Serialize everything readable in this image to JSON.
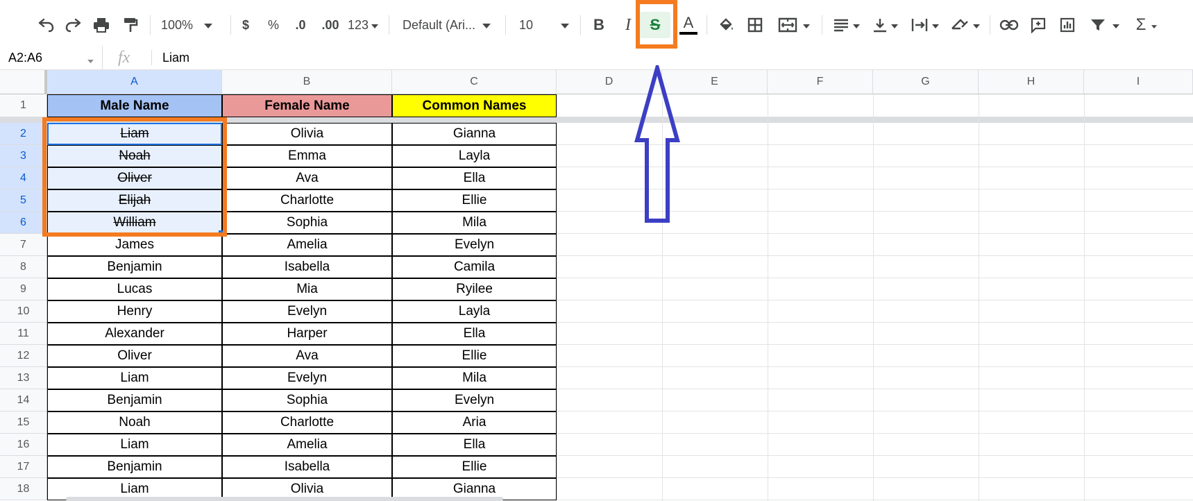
{
  "toolbar": {
    "zoom": "100%",
    "currency": "$",
    "percent": "%",
    "decrease_decimal": ".0",
    "increase_decimal": ".00",
    "number_format": "123",
    "font": "Default (Ari...",
    "font_size": "10",
    "bold": "B",
    "italic": "I",
    "strikethrough": "S",
    "text_color": "A",
    "sum": "Σ"
  },
  "formula_bar": {
    "name_box": "A2:A6",
    "fx": "fx",
    "value": "Liam"
  },
  "columns": [
    "A",
    "B",
    "C",
    "D",
    "E",
    "F",
    "G",
    "H",
    "I"
  ],
  "rows": [
    "1",
    "2",
    "3",
    "4",
    "5",
    "6",
    "7",
    "8",
    "9",
    "10",
    "11",
    "12",
    "13",
    "14",
    "15",
    "16",
    "17",
    "18"
  ],
  "headers": [
    "Male Name",
    "Female Name",
    "Common Names"
  ],
  "header_colors": [
    "#a4c2f4",
    "#ea9999",
    "#ffff00"
  ],
  "data": [
    [
      "Liam",
      "Olivia",
      "Gianna"
    ],
    [
      "Noah",
      "Emma",
      "Layla"
    ],
    [
      "Oliver",
      "Ava",
      "Ella"
    ],
    [
      "Elijah",
      "Charlotte",
      "Ellie"
    ],
    [
      "William",
      "Sophia",
      "Mila"
    ],
    [
      "James",
      "Amelia",
      "Evelyn"
    ],
    [
      "Benjamin",
      "Isabella",
      "Camila"
    ],
    [
      "Lucas",
      "Mia",
      "Ryilee"
    ],
    [
      "Henry",
      "Evelyn",
      "Layla"
    ],
    [
      "Alexander",
      "Harper",
      "Ella"
    ],
    [
      "Oliver",
      "Ava",
      "Ellie"
    ],
    [
      "Liam",
      "Evelyn",
      "Mila"
    ],
    [
      "Benjamin",
      "Sophia",
      "Evelyn"
    ],
    [
      "Noah",
      "Charlotte",
      "Aria"
    ],
    [
      "Liam",
      "Amelia",
      "Ella"
    ],
    [
      "Benjamin",
      "Isabella",
      "Ellie"
    ],
    [
      "Liam",
      "Olivia",
      "Gianna"
    ]
  ],
  "strikethrough_rows": 5,
  "colors": {
    "highlight_orange": "#f47b20",
    "arrow_blue": "#3c3fc4",
    "selection_fill": "#e8f0fe",
    "selection_border": "#1a73e8",
    "strike_active_bg": "#e6f4ea",
    "strike_active_fg": "#188038"
  }
}
